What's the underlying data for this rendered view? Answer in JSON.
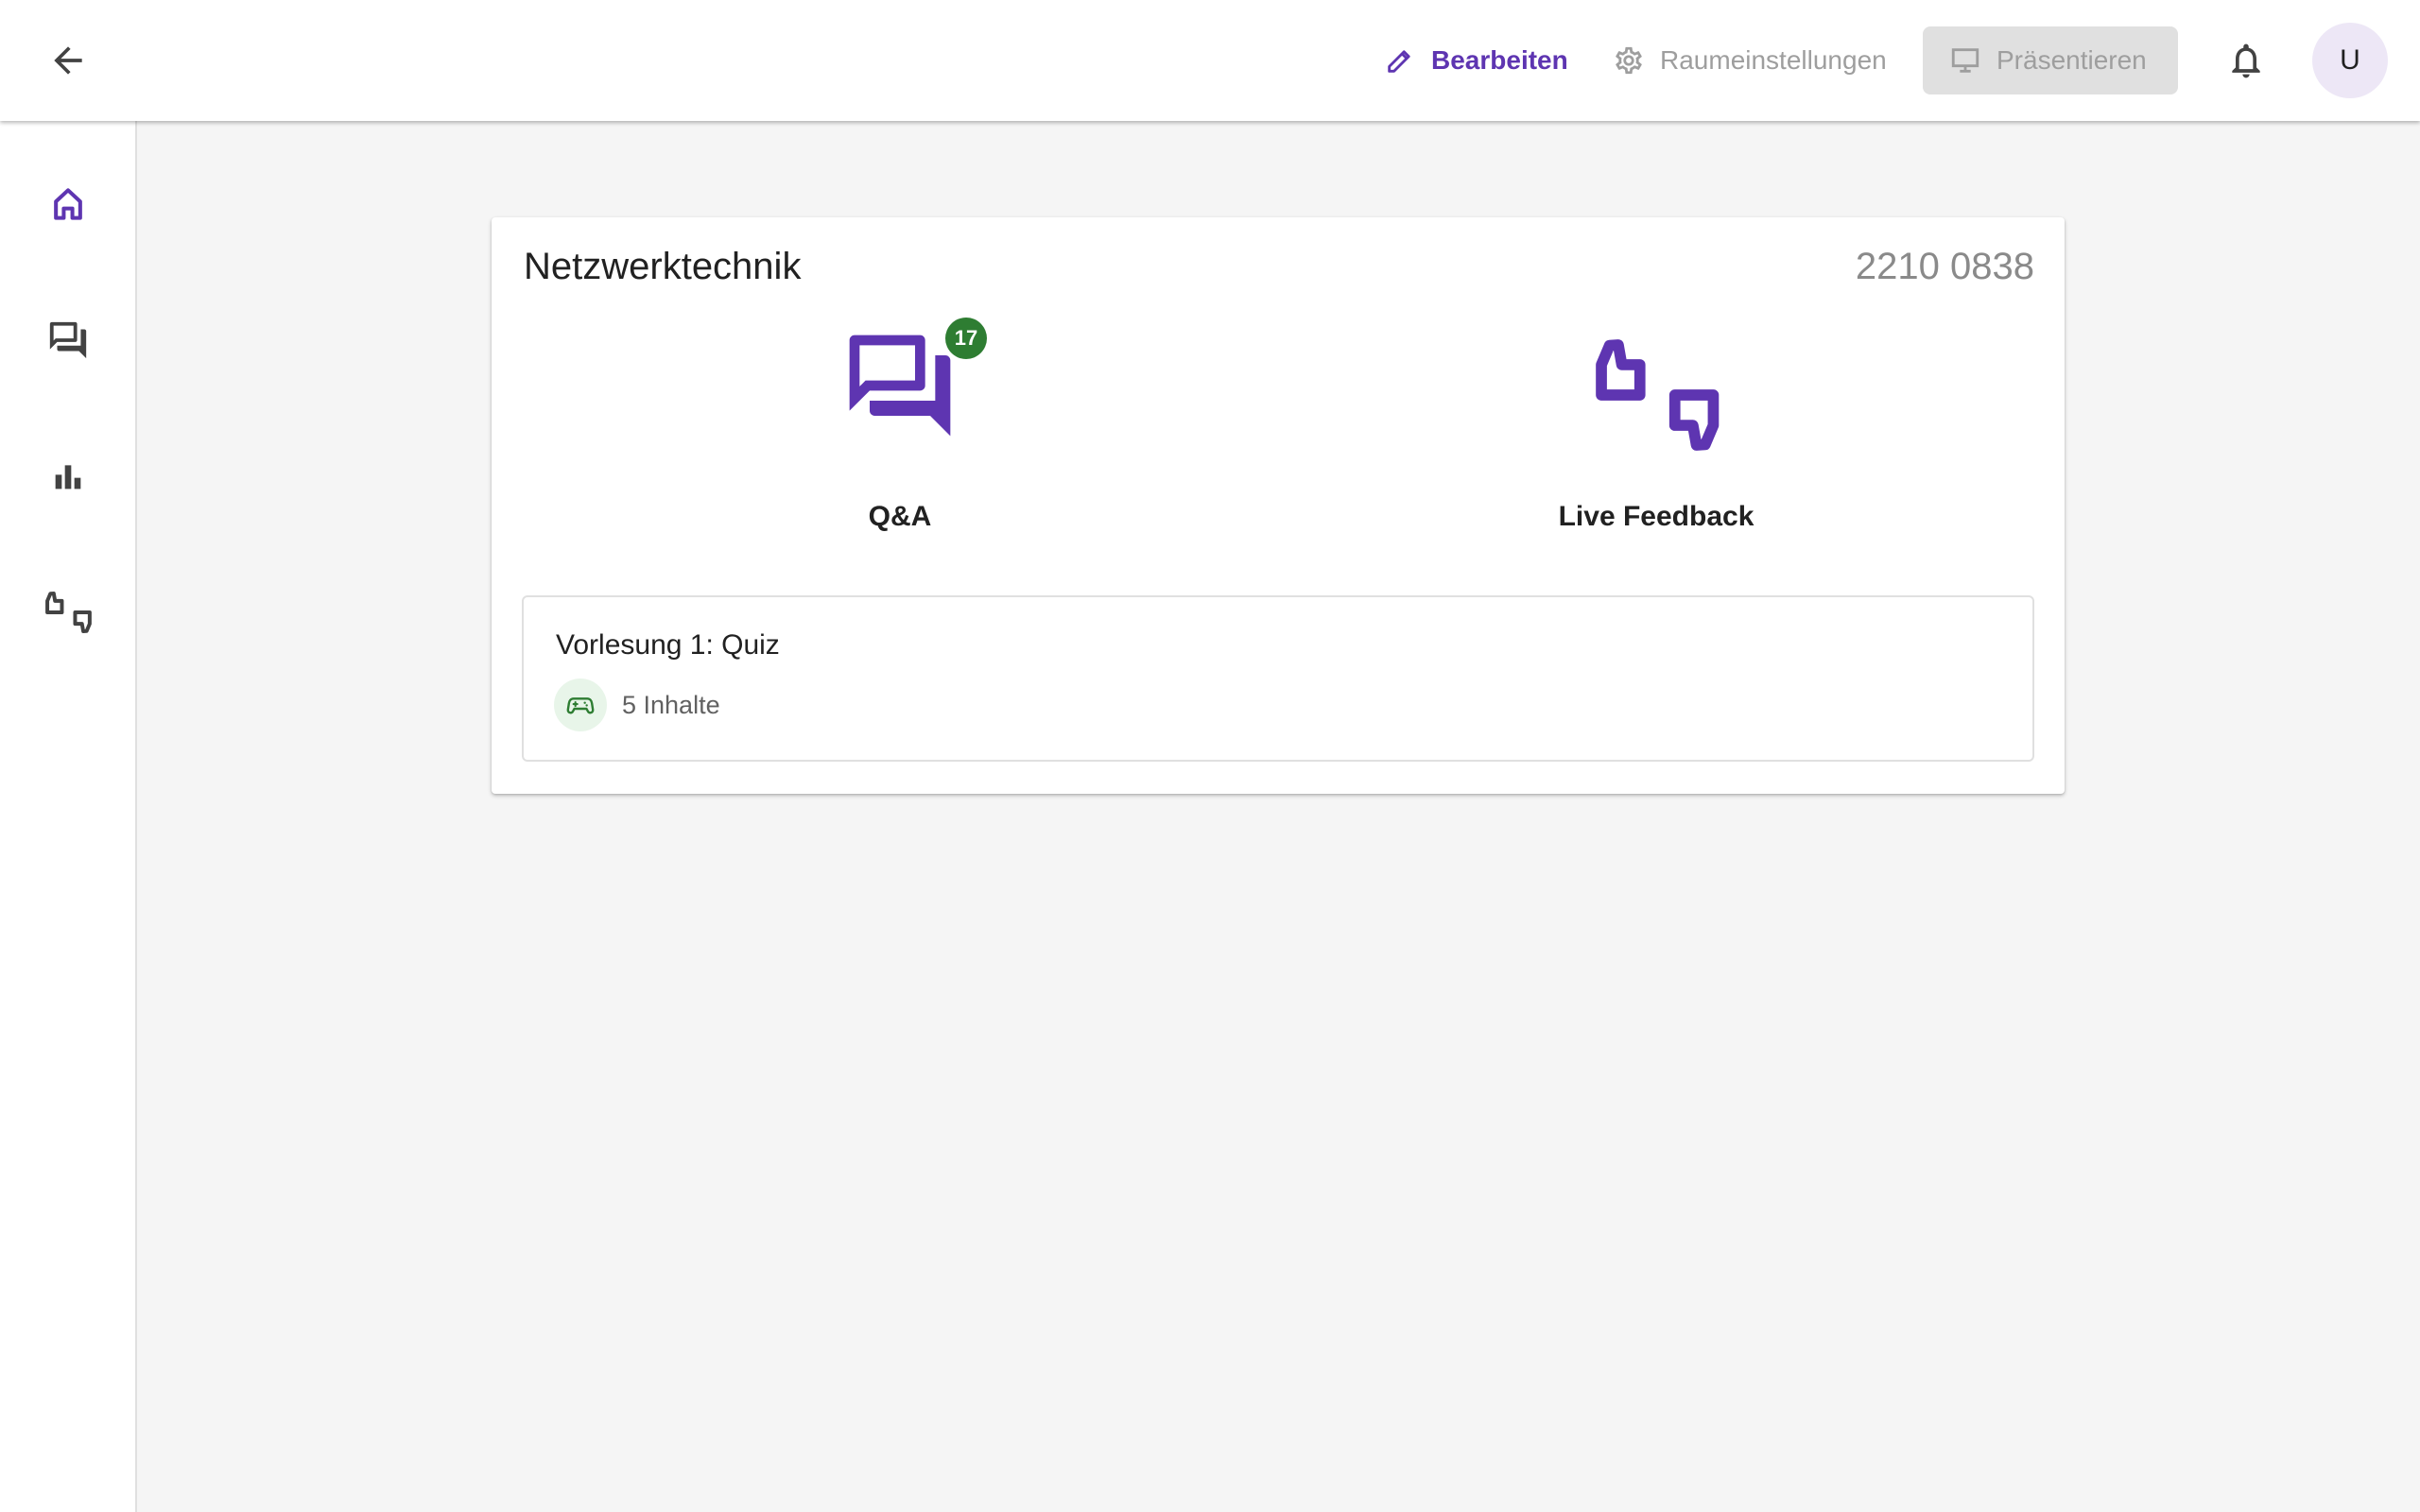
{
  "header": {
    "back_icon": "arrow-back-icon",
    "edit_label": "Bearbeiten",
    "settings_label": "Raumeinstellungen",
    "present_label": "Präsentieren",
    "avatar_initial": "U",
    "colors": {
      "accent": "#5e35b1",
      "muted": "#9e9e9e",
      "present_bg": "#e0e0e0"
    }
  },
  "sidebar": {
    "items": [
      {
        "icon": "home-icon",
        "active": true
      },
      {
        "icon": "forum-icon",
        "active": false
      },
      {
        "icon": "bar-chart-icon",
        "active": false
      },
      {
        "icon": "thumbs-up-down-icon",
        "active": false
      }
    ]
  },
  "room": {
    "name": "Netzwerktechnik",
    "code": "2210 0838",
    "features": [
      {
        "icon": "forum-icon",
        "label": "Q&A",
        "badge": "17"
      },
      {
        "icon": "thumbs-up-down-icon",
        "label": "Live Feedback"
      }
    ],
    "content_group": {
      "title": "Vorlesung 1: Quiz",
      "icon": "gamepad-icon",
      "count_label": "5 Inhalte"
    },
    "colors": {
      "feature_icon": "#5e35b1",
      "badge": "#2e7d32"
    }
  }
}
